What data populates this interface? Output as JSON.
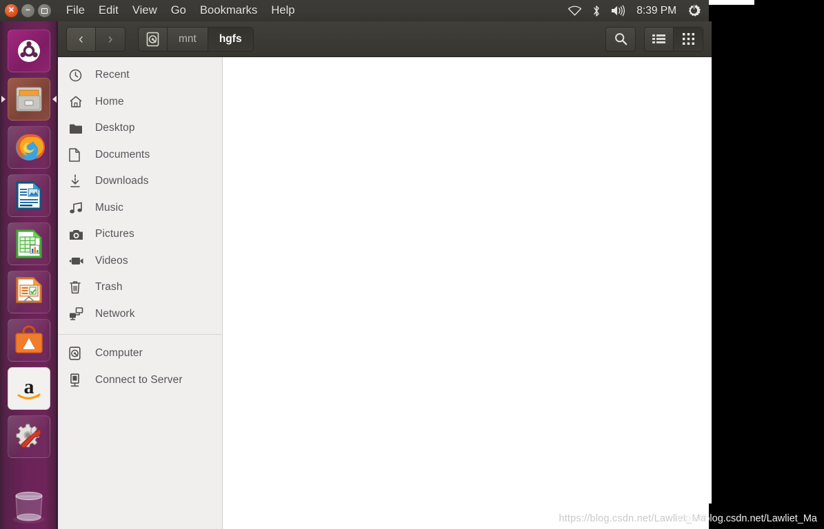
{
  "panel": {
    "window_controls": [
      {
        "name": "close",
        "glyph": "✕"
      },
      {
        "name": "minimize",
        "glyph": "−"
      },
      {
        "name": "maximize",
        "glyph": ""
      }
    ],
    "menus": [
      "File",
      "Edit",
      "View",
      "Go",
      "Bookmarks",
      "Help"
    ],
    "indicators": {
      "wifi": "wifi-icon",
      "bluetooth": "bluetooth-icon",
      "volume": "volume-icon",
      "clock": "8:39 PM",
      "session": "session-gear-icon"
    }
  },
  "launcher": {
    "items": [
      {
        "label": "Ubuntu Dash",
        "icon": "ubuntu-logo-icon",
        "active": false
      },
      {
        "label": "Files",
        "icon": "file-manager-icon",
        "active": true
      },
      {
        "label": "Firefox",
        "icon": "firefox-icon",
        "active": false
      },
      {
        "label": "LibreOffice Writer",
        "icon": "libreoffice-writer-icon",
        "active": false
      },
      {
        "label": "LibreOffice Calc",
        "icon": "libreoffice-calc-icon",
        "active": false
      },
      {
        "label": "LibreOffice Impress",
        "icon": "libreoffice-impress-icon",
        "active": false
      },
      {
        "label": "Ubuntu Software Center",
        "icon": "software-center-icon",
        "active": false
      },
      {
        "label": "Amazon",
        "icon": "amazon-icon",
        "active": false
      },
      {
        "label": "System Settings",
        "icon": "system-settings-icon",
        "active": false
      }
    ],
    "trash": {
      "label": "Trash",
      "icon": "trash-bin-icon"
    }
  },
  "toolbar": {
    "back_glyph": "‹",
    "forward_glyph": "›",
    "breadcrumbs": [
      {
        "label": "",
        "icon": "hard-disk-icon",
        "active": false
      },
      {
        "label": "mnt",
        "icon": "",
        "active": false
      },
      {
        "label": "hgfs",
        "icon": "",
        "active": true
      }
    ],
    "search_icon": "search-icon",
    "list_view_icon": "list-view-icon",
    "grid_view_icon": "grid-view-icon"
  },
  "sidebar": {
    "items": [
      {
        "label": "Recent",
        "icon": "clock-icon"
      },
      {
        "label": "Home",
        "icon": "home-icon"
      },
      {
        "label": "Desktop",
        "icon": "folder-icon"
      },
      {
        "label": "Documents",
        "icon": "document-icon"
      },
      {
        "label": "Downloads",
        "icon": "download-icon"
      },
      {
        "label": "Music",
        "icon": "music-note-icon"
      },
      {
        "label": "Pictures",
        "icon": "camera-icon"
      },
      {
        "label": "Videos",
        "icon": "video-camera-icon"
      },
      {
        "label": "Trash",
        "icon": "trash-icon"
      },
      {
        "label": "Network",
        "icon": "network-icon"
      }
    ],
    "devices": [
      {
        "label": "Computer",
        "icon": "hard-disk-icon"
      },
      {
        "label": "Connect to Server",
        "icon": "server-icon"
      }
    ]
  },
  "content": {
    "files": [],
    "watermark": "https://blog.csdn.net/Lawliet_Ma"
  },
  "colors": {
    "panel_bg": "#3b3a36",
    "launcher_bg": "#6b2358",
    "sidebar_bg": "#f0efee",
    "content_bg": "#ffffff",
    "accent_orange": "#dd4814",
    "text_dark": "#55545a"
  }
}
